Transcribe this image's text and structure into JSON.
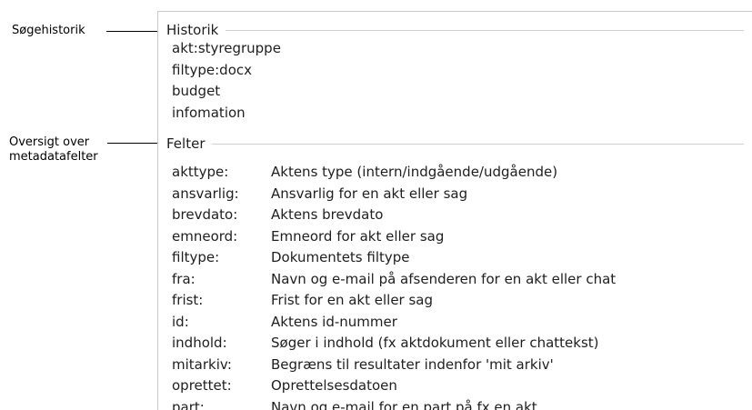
{
  "annotations": {
    "search_history": "Søgehistorik",
    "metadata_overview_line1": "Oversigt over",
    "metadata_overview_line2": "metadatafelter"
  },
  "history": {
    "title": "Historik",
    "items": [
      "akt:styregruppe",
      "filtype:docx",
      "budget",
      "infomation"
    ]
  },
  "fields": {
    "title": "Felter",
    "items": [
      {
        "key": "akttype:",
        "desc": "Aktens type (intern/indgående/udgående)"
      },
      {
        "key": "ansvarlig:",
        "desc": "Ansvarlig for en akt eller sag"
      },
      {
        "key": "brevdato:",
        "desc": "Aktens brevdato"
      },
      {
        "key": "emneord:",
        "desc": "Emneord for akt eller sag"
      },
      {
        "key": "filtype:",
        "desc": "Dokumentets filtype"
      },
      {
        "key": "fra:",
        "desc": "Navn og e-mail på afsenderen for en akt eller chat"
      },
      {
        "key": "frist:",
        "desc": "Frist for en akt eller sag"
      },
      {
        "key": "id:",
        "desc": "Aktens id-nummer"
      },
      {
        "key": "indhold:",
        "desc": "Søger i indhold (fx aktdokument eller chattekst)"
      },
      {
        "key": "mitarkiv:",
        "desc": "Begræns til resultater indenfor 'mit arkiv'"
      },
      {
        "key": "oprettet:",
        "desc": "Oprettelsesdatoen"
      },
      {
        "key": "part:",
        "desc": "Navn og e-mail for en part på fx en akt"
      }
    ]
  }
}
